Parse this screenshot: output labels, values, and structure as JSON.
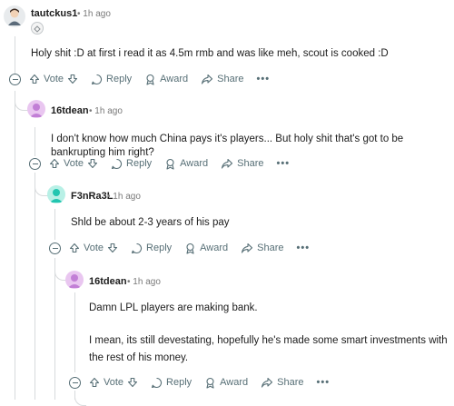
{
  "comments": [
    {
      "username": "tautckus1",
      "time": "1h ago",
      "body": [
        "Holy shit :D at first i read it as 4.5m rmb and was like meh, scout is cooked :D"
      ],
      "avatar_color": "#cfd5da"
    },
    {
      "username": "16tdean",
      "time": "1h ago",
      "body": [
        "I don't know how much China pays it's players... But holy shit that's got to be bankrupting him right?"
      ],
      "avatar_color": "#d9a3e6"
    },
    {
      "username": "F3nRa3L",
      "time": "1h ago",
      "body": [
        "Shld be about 2-3 years of his pay"
      ],
      "avatar_color": "#22c5b0"
    },
    {
      "username": "16tdean",
      "time": "1h ago",
      "body": [
        "Damn LPL players are making bank.",
        "I mean, its still devestating, hopefully he's made some smart investments with the rest of his money."
      ],
      "avatar_color": "#d9a3e6"
    }
  ],
  "actions": {
    "vote": "Vote",
    "reply": "Reply",
    "award": "Award",
    "share": "Share",
    "more": "•••"
  },
  "separator": "•"
}
